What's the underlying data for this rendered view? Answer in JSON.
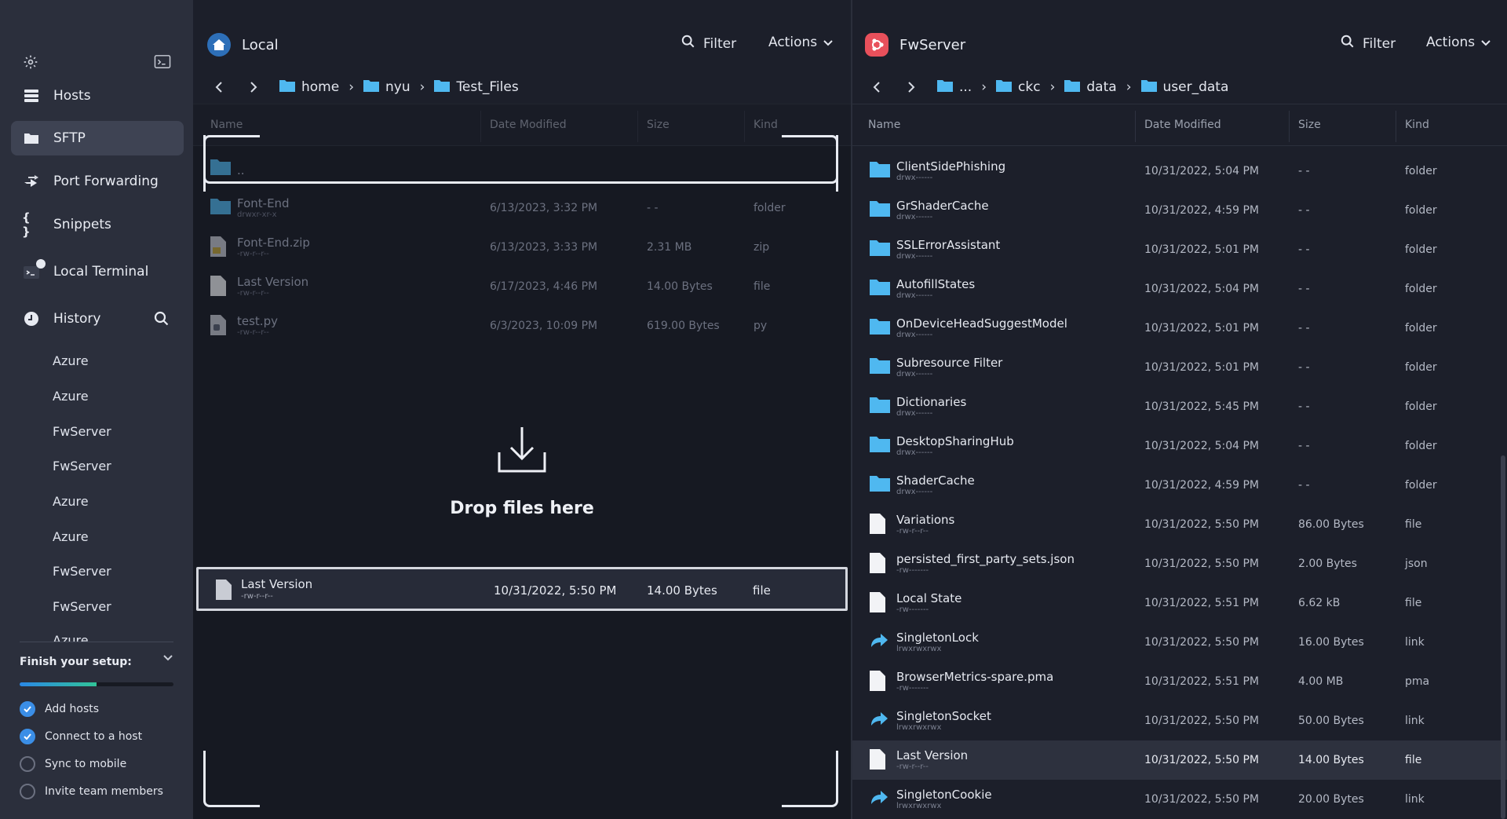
{
  "sidebar": {
    "nav": [
      {
        "label": "Hosts",
        "icon": "hosts-icon"
      },
      {
        "label": "SFTP",
        "icon": "folder-icon"
      },
      {
        "label": "Port Forwarding",
        "icon": "port-forward-icon"
      },
      {
        "label": "Snippets",
        "icon": "snippets-icon"
      },
      {
        "label": "Local Terminal",
        "icon": "terminal-icon"
      },
      {
        "label": "History",
        "icon": "history-icon"
      }
    ],
    "history": [
      "Azure",
      "Azure",
      "FwServer",
      "FwServer",
      "Azure",
      "Azure",
      "FwServer",
      "FwServer",
      "Azure"
    ],
    "setup": {
      "title": "Finish your setup:",
      "progress": 0.5,
      "items": [
        {
          "label": "Add hosts",
          "done": true
        },
        {
          "label": "Connect to a host",
          "done": true
        },
        {
          "label": "Sync to mobile",
          "done": false
        },
        {
          "label": "Invite team members",
          "done": false
        }
      ]
    }
  },
  "local": {
    "title": "Local",
    "filter": "Filter",
    "actions": "Actions",
    "crumbs": [
      "home",
      "nyu",
      "Test_Files"
    ],
    "columns": [
      "Name",
      "Date Modified",
      "Size",
      "Kind"
    ],
    "rows": [
      {
        "name": "..",
        "perm": "",
        "date": "",
        "size": "",
        "kind": "",
        "type": "folder"
      },
      {
        "name": "Font-End",
        "perm": "drwxr-xr-x",
        "date": "6/13/2023, 3:32 PM",
        "size": "- -",
        "kind": "folder",
        "type": "folder"
      },
      {
        "name": "Font-End.zip",
        "perm": "-rw-r--r--",
        "date": "6/13/2023, 3:33 PM",
        "size": "2.31 MB",
        "kind": "zip",
        "type": "zip"
      },
      {
        "name": "Last Version",
        "perm": "-rw-r--r--",
        "date": "6/17/2023, 4:46 PM",
        "size": "14.00 Bytes",
        "kind": "file",
        "type": "file"
      },
      {
        "name": "test.py",
        "perm": "-rw-r--r--",
        "date": "6/3/2023, 10:09 PM",
        "size": "619.00 Bytes",
        "kind": "py",
        "type": "py"
      }
    ],
    "drop_text": "Drop files here",
    "drag": {
      "name": "Last Version",
      "perm": "-rw-r--r--",
      "date": "10/31/2022, 5:50 PM",
      "size": "14.00 Bytes",
      "kind": "file"
    }
  },
  "remote": {
    "title": "FwServer",
    "filter": "Filter",
    "actions": "Actions",
    "crumbs": [
      "...",
      "ckc",
      "data",
      "user_data"
    ],
    "columns": [
      "Name",
      "Date Modified",
      "Size",
      "Kind"
    ],
    "rows": [
      {
        "name": "ClientSidePhishing",
        "perm": "drwx------",
        "date": "10/31/2022, 5:04 PM",
        "size": "- -",
        "kind": "folder",
        "type": "folder"
      },
      {
        "name": "GrShaderCache",
        "perm": "drwx------",
        "date": "10/31/2022, 4:59 PM",
        "size": "- -",
        "kind": "folder",
        "type": "folder"
      },
      {
        "name": "SSLErrorAssistant",
        "perm": "drwx------",
        "date": "10/31/2022, 5:01 PM",
        "size": "- -",
        "kind": "folder",
        "type": "folder"
      },
      {
        "name": "AutofillStates",
        "perm": "drwx------",
        "date": "10/31/2022, 5:04 PM",
        "size": "- -",
        "kind": "folder",
        "type": "folder"
      },
      {
        "name": "OnDeviceHeadSuggestModel",
        "perm": "drwx------",
        "date": "10/31/2022, 5:01 PM",
        "size": "- -",
        "kind": "folder",
        "type": "folder"
      },
      {
        "name": "Subresource Filter",
        "perm": "drwx------",
        "date": "10/31/2022, 5:01 PM",
        "size": "- -",
        "kind": "folder",
        "type": "folder"
      },
      {
        "name": "Dictionaries",
        "perm": "drwx------",
        "date": "10/31/2022, 5:45 PM",
        "size": "- -",
        "kind": "folder",
        "type": "folder"
      },
      {
        "name": "DesktopSharingHub",
        "perm": "drwx------",
        "date": "10/31/2022, 5:04 PM",
        "size": "- -",
        "kind": "folder",
        "type": "folder"
      },
      {
        "name": "ShaderCache",
        "perm": "drwx------",
        "date": "10/31/2022, 4:59 PM",
        "size": "- -",
        "kind": "folder",
        "type": "folder"
      },
      {
        "name": "Variations",
        "perm": "-rw-r--r--",
        "date": "10/31/2022, 5:50 PM",
        "size": "86.00 Bytes",
        "kind": "file",
        "type": "file"
      },
      {
        "name": "persisted_first_party_sets.json",
        "perm": "-rw-------",
        "date": "10/31/2022, 5:50 PM",
        "size": "2.00 Bytes",
        "kind": "json",
        "type": "file"
      },
      {
        "name": "Local State",
        "perm": "-rw-------",
        "date": "10/31/2022, 5:51 PM",
        "size": "6.62 kB",
        "kind": "file",
        "type": "file"
      },
      {
        "name": "SingletonLock",
        "perm": "lrwxrwxrwx",
        "date": "10/31/2022, 5:50 PM",
        "size": "16.00 Bytes",
        "kind": "link",
        "type": "link"
      },
      {
        "name": "BrowserMetrics-spare.pma",
        "perm": "-rw-------",
        "date": "10/31/2022, 5:51 PM",
        "size": "4.00 MB",
        "kind": "pma",
        "type": "file"
      },
      {
        "name": "SingletonSocket",
        "perm": "lrwxrwxrwx",
        "date": "10/31/2022, 5:50 PM",
        "size": "50.00 Bytes",
        "kind": "link",
        "type": "link"
      },
      {
        "name": "Last Version",
        "perm": "-rw-r--r--",
        "date": "10/31/2022, 5:50 PM",
        "size": "14.00 Bytes",
        "kind": "file",
        "type": "file",
        "selected": true
      },
      {
        "name": "SingletonCookie",
        "perm": "lrwxrwxrwx",
        "date": "10/31/2022, 5:50 PM",
        "size": "20.00 Bytes",
        "kind": "link",
        "type": "link"
      }
    ]
  },
  "colors": {
    "accent": "#3b8ee6",
    "folder": "#4fb8f0",
    "remote_badge": "#e8505b",
    "local_badge": "#2d6fb8"
  }
}
